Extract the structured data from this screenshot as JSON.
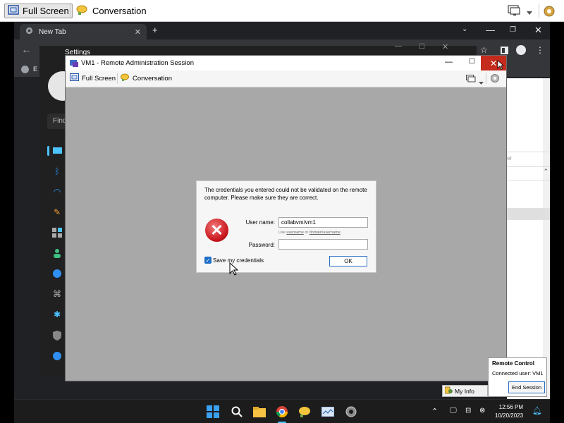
{
  "host_toolbar": {
    "full_screen_label": "Full Screen",
    "conversation_label": "Conversation"
  },
  "chrome": {
    "tab_title": "New Tab",
    "bookmark_label": "E"
  },
  "settings": {
    "title": "Settings",
    "find_placeholder": "Find"
  },
  "vm_window": {
    "title": "VM1 - Remote Administration Session",
    "toolbar": {
      "full_screen_label": "Full Screen",
      "conversation_label": "Conversation"
    }
  },
  "credentials_dialog": {
    "message": "The credentials you entered could not be validated on the remote computer. Please make sure they are correct.",
    "username_label": "User name:",
    "username_value": "collabvm/vm1",
    "hint_prefix": "Use",
    "hint_username": "username",
    "hint_or": "or",
    "hint_domain": "domain\\username",
    "password_label": "Password:",
    "password_value": "",
    "save_credentials_label": "Save my credentials",
    "save_credentials_checked": true,
    "ok_label": "OK"
  },
  "remote_control": {
    "title": "Remote Control",
    "connected_user": "Connected user:  VM1",
    "end_session_label": "End Session"
  },
  "my_info_label": "My Info",
  "right_panel_text": "er",
  "taskbar": {
    "time": "12:56 PM",
    "date": "10/20/2023"
  }
}
